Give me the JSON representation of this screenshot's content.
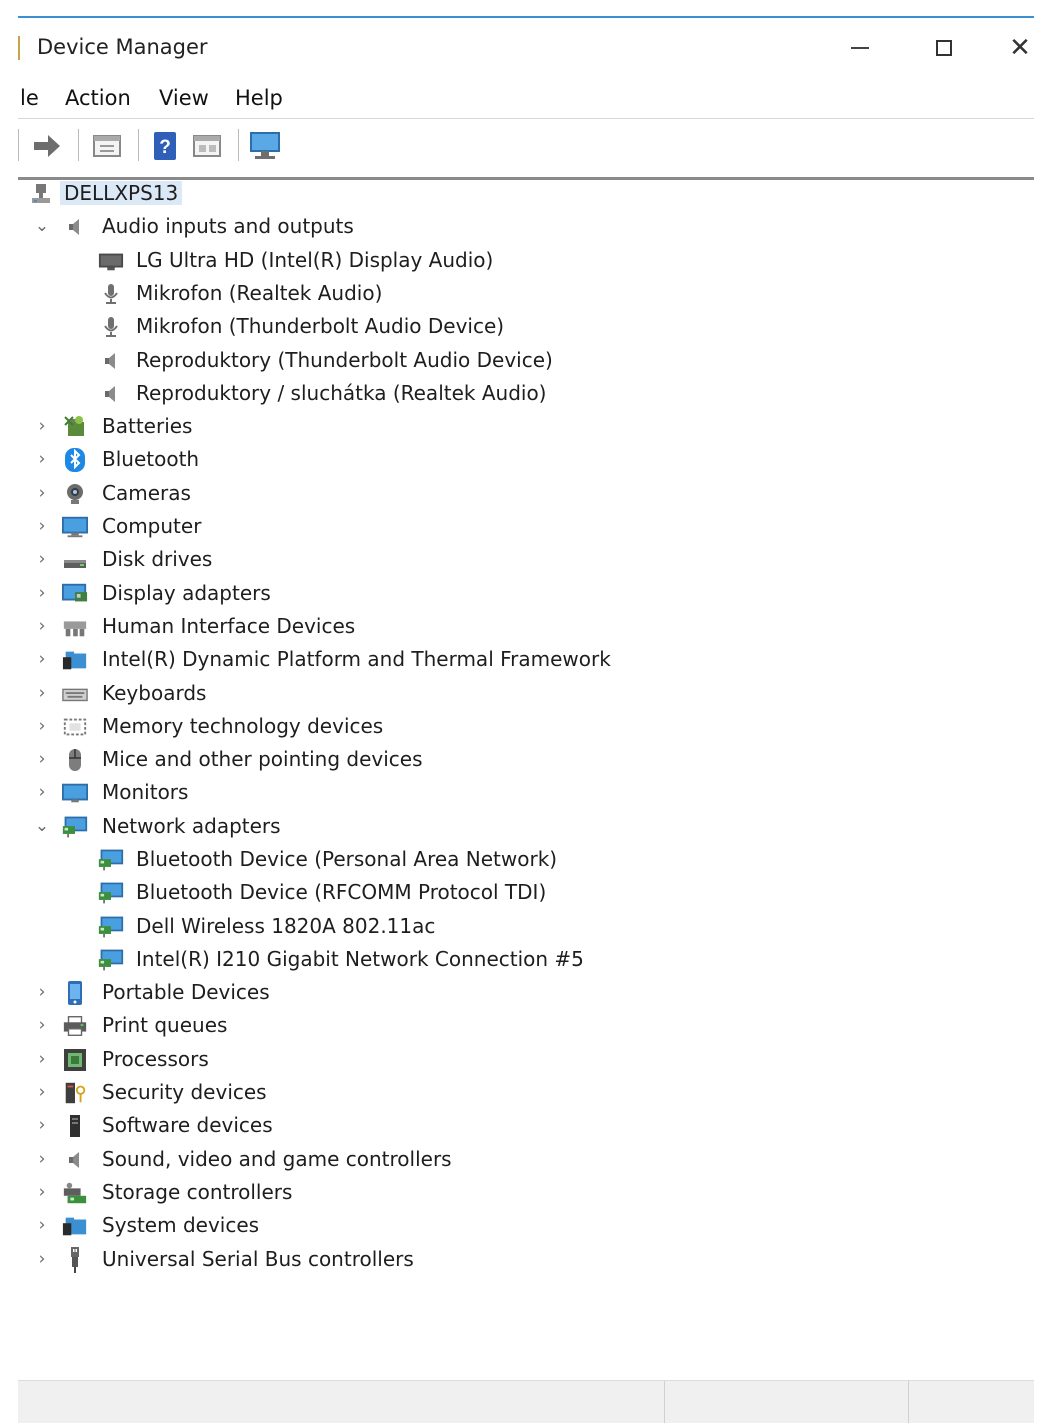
{
  "window": {
    "title": "Device Manager"
  },
  "menu": [
    "le",
    "Action",
    "View",
    "Help"
  ],
  "toolbar": {
    "buttons": [
      {
        "icon": "forward-arrow-icon"
      },
      {
        "icon": "properties-icon"
      },
      {
        "icon": "help-icon"
      },
      {
        "icon": "details-view-icon"
      },
      {
        "icon": "monitor-scan-icon"
      }
    ]
  },
  "tree": {
    "root": "DELLXPS13",
    "categories": [
      {
        "label": "Audio inputs and outputs",
        "icon": "speaker-icon",
        "expanded": true,
        "children": [
          {
            "label": "LG Ultra HD (Intel(R) Display Audio)",
            "icon": "display-audio-icon"
          },
          {
            "label": "Mikrofon (Realtek Audio)",
            "icon": "microphone-icon"
          },
          {
            "label": "Mikrofon (Thunderbolt Audio Device)",
            "icon": "microphone-icon"
          },
          {
            "label": "Reproduktory (Thunderbolt Audio Device)",
            "icon": "speaker-icon"
          },
          {
            "label": "Reproduktory / sluchátka (Realtek Audio)",
            "icon": "speaker-icon"
          }
        ]
      },
      {
        "label": "Batteries",
        "icon": "battery-icon",
        "expanded": false,
        "children": []
      },
      {
        "label": "Bluetooth",
        "icon": "bluetooth-icon",
        "expanded": false,
        "children": []
      },
      {
        "label": "Cameras",
        "icon": "camera-icon",
        "expanded": false,
        "children": []
      },
      {
        "label": "Computer",
        "icon": "computer-icon",
        "expanded": false,
        "children": []
      },
      {
        "label": "Disk drives",
        "icon": "disk-drive-icon",
        "expanded": false,
        "children": []
      },
      {
        "label": "Display adapters",
        "icon": "display-adapter-icon",
        "expanded": false,
        "children": []
      },
      {
        "label": "Human Interface Devices",
        "icon": "hid-icon",
        "expanded": false,
        "children": []
      },
      {
        "label": "Intel(R) Dynamic Platform and Thermal Framework",
        "icon": "system-folder-icon",
        "expanded": false,
        "children": []
      },
      {
        "label": "Keyboards",
        "icon": "keyboard-icon",
        "expanded": false,
        "children": []
      },
      {
        "label": "Memory technology devices",
        "icon": "memory-icon",
        "expanded": false,
        "children": []
      },
      {
        "label": "Mice and other pointing devices",
        "icon": "mouse-icon",
        "expanded": false,
        "children": []
      },
      {
        "label": "Monitors",
        "icon": "monitor-icon",
        "expanded": false,
        "children": []
      },
      {
        "label": "Network adapters",
        "icon": "network-adapter-icon",
        "expanded": true,
        "children": [
          {
            "label": "Bluetooth Device (Personal Area Network)",
            "icon": "network-adapter-icon"
          },
          {
            "label": "Bluetooth Device (RFCOMM Protocol TDI)",
            "icon": "network-adapter-icon"
          },
          {
            "label": "Dell Wireless 1820A 802.11ac",
            "icon": "network-adapter-icon"
          },
          {
            "label": "Intel(R) I210 Gigabit Network Connection #5",
            "icon": "network-adapter-icon"
          }
        ]
      },
      {
        "label": "Portable Devices",
        "icon": "portable-device-icon",
        "expanded": false,
        "children": []
      },
      {
        "label": "Print queues",
        "icon": "printer-icon",
        "expanded": false,
        "children": []
      },
      {
        "label": "Processors",
        "icon": "processor-icon",
        "expanded": false,
        "children": []
      },
      {
        "label": "Security devices",
        "icon": "security-device-icon",
        "expanded": false,
        "children": []
      },
      {
        "label": "Software devices",
        "icon": "software-device-icon",
        "expanded": false,
        "children": []
      },
      {
        "label": "Sound, video and game controllers",
        "icon": "speaker-icon",
        "expanded": false,
        "children": []
      },
      {
        "label": "Storage controllers",
        "icon": "storage-controller-icon",
        "expanded": false,
        "children": []
      },
      {
        "label": "System devices",
        "icon": "system-folder-icon",
        "expanded": false,
        "children": []
      },
      {
        "label": "Universal Serial Bus controllers",
        "icon": "usb-icon",
        "expanded": false,
        "children": []
      }
    ]
  }
}
